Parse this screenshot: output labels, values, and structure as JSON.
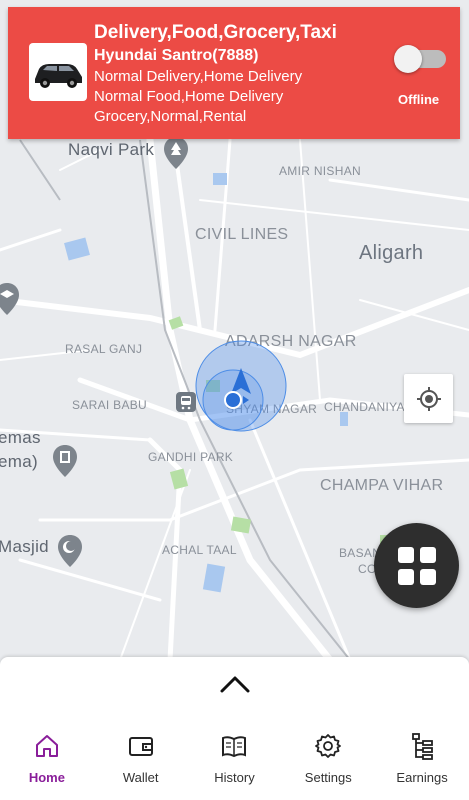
{
  "driver": {
    "services": "Delivery,Food,Grocery,Taxi",
    "vehicle": "Hyundai Santro(7888)",
    "line1": "Normal Delivery,Home Delivery",
    "line2": "Normal Food,Home Delivery",
    "line3": "Grocery,Normal,Rental",
    "status_label": "Offline",
    "online": false
  },
  "map": {
    "labels": {
      "naqvi_park": "Naqvi Park",
      "amir_nishan": "AMIR NISHAN",
      "civil_lines": "CIVIL LINES",
      "aligarh": "Aligarh",
      "adarsh_nagar": "ADARSH NAGAR",
      "rasal_ganj": "RASAL GANJ",
      "sarai_babu": "SARAI BABU",
      "shyam_nagar": "SHYAM NAGAR",
      "chandaniya": "CHANDANIYA",
      "cinemas": "emas",
      "cinema": "ema)",
      "gandhi_park": "GANDHI PARK",
      "champa_vihar": "CHAMPA VIHAR",
      "masjid": "Masjid",
      "achal_taal": "ACHAL TAAL",
      "basan": "BASAN",
      "co": "CO"
    }
  },
  "nav": {
    "items": [
      {
        "label": "Home",
        "icon": "home-icon",
        "active": true
      },
      {
        "label": "Wallet",
        "icon": "wallet-icon",
        "active": false
      },
      {
        "label": "History",
        "icon": "history-icon",
        "active": false
      },
      {
        "label": "Settings",
        "icon": "settings-icon",
        "active": false
      },
      {
        "label": "Earnings",
        "icon": "earnings-icon",
        "active": false
      }
    ]
  },
  "colors": {
    "card": "#ec4b45",
    "active_nav": "#8a1e9a",
    "location_blue": "#2a6fd6"
  }
}
